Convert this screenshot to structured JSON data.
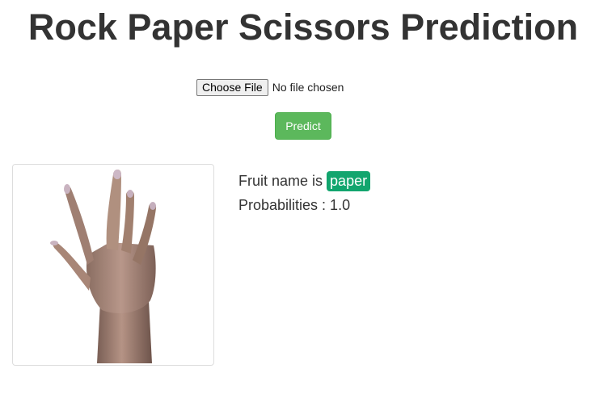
{
  "page": {
    "title": "Rock Paper Scissors Prediction"
  },
  "upload": {
    "choose_label": "Choose File",
    "status": "No file chosen"
  },
  "predict": {
    "label": "Predict",
    "color": "#5cb85c"
  },
  "image": {
    "description_icon": "open-hand-image"
  },
  "result": {
    "name_prefix": "Fruit name is",
    "name_value": "paper",
    "badge_color": "#12a56e",
    "prob_label": "Probabilities : 1.0"
  }
}
